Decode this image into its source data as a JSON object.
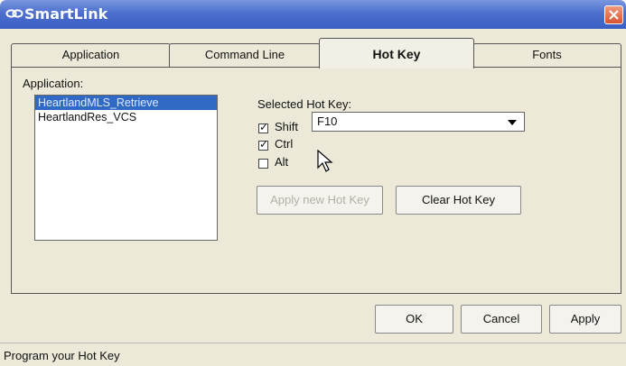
{
  "title": "SmartLink",
  "tabs": [
    {
      "label": "Application"
    },
    {
      "label": "Command Line"
    },
    {
      "label": "Hot Key"
    },
    {
      "label": "Fonts"
    }
  ],
  "panel": {
    "application_label": "Application:",
    "applications": [
      "HeartlandMLS_Retrieve",
      "HeartlandRes_VCS"
    ],
    "selected_hotkey_label": "Selected Hot Key:",
    "modifiers": [
      {
        "label": "Shift",
        "checked": true
      },
      {
        "label": "Ctrl",
        "checked": true
      },
      {
        "label": "Alt",
        "checked": false
      }
    ],
    "key_value": "F10",
    "apply_new_hotkey": "Apply new Hot Key",
    "clear_hotkey": "Clear Hot Key"
  },
  "dialog_buttons": {
    "ok": "OK",
    "cancel": "Cancel",
    "apply": "Apply"
  },
  "status": "Program your Hot Key",
  "colors": {
    "titlebar": "#3a5fc4",
    "selection": "#316ac5",
    "face": "#ece9d8"
  }
}
